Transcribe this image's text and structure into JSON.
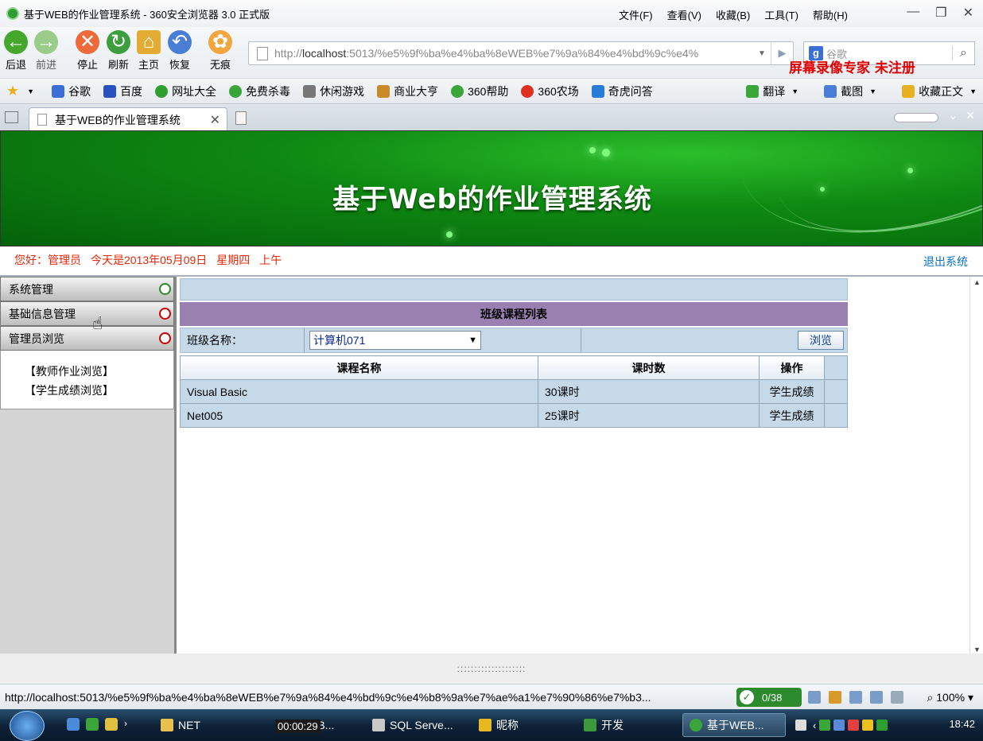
{
  "browser": {
    "window_title": "基于WEB的作业管理系统 - 360安全浏览器 3.0 正式版",
    "menus": [
      "文件(F)",
      "查看(V)",
      "收藏(B)",
      "工具(T)",
      "帮助(H)"
    ],
    "nav_buttons": {
      "back": "后退",
      "forward": "前进",
      "stop": "停止",
      "refresh": "刷新",
      "home": "主页",
      "restore": "恢复",
      "stealth": "无痕"
    },
    "address_prefix": "http://",
    "address_host": "localhost",
    "address_rest": ":5013/%e5%9f%ba%e4%ba%8eWEB%e7%9a%84%e4%bd%9c%e4%",
    "search_placeholder": "谷歌",
    "search_engine_icon": "g",
    "watermark": "屏幕录像专家  未注册",
    "favorites": [
      "谷歌",
      "百度",
      "网址大全",
      "免费杀毒",
      "休闲游戏",
      "商业大亨",
      "360帮助",
      "360农场",
      "奇虎问答"
    ],
    "fav_colors": [
      "#3a6fd8",
      "#2a52be",
      "#2e9e2e",
      "#3aa63a",
      "#777777",
      "#c98a2a",
      "#3aa63a",
      "#e03020",
      "#2a7ad8"
    ],
    "fav_right": [
      "翻译",
      "截图",
      "收藏正文"
    ],
    "tab_title": "基于WEB的作业管理系统",
    "status_url": "http://localhost:5013/%e5%9f%ba%e4%ba%8eWEB%e7%9a%84%e4%bd%9c%e4%b8%9a%e7%ae%a1%e7%90%86%e7%b3...",
    "counter": "0/38",
    "zoom": "100%"
  },
  "site": {
    "banner_title": "基于Web的作业管理系统",
    "greeting": "您好：管理员",
    "date": "今天是2013年05月09日",
    "weekday": "星期四",
    "period": "上午",
    "logout": "退出系统"
  },
  "sidebar": {
    "menus": [
      "系统管理",
      "基础信息管理",
      "管理员浏览"
    ],
    "items": [
      "【教师作业浏览】",
      "【学生成绩浏览】"
    ]
  },
  "main": {
    "list_title": "班级课程列表",
    "class_label": "班级名称：",
    "class_selected": "计算机071",
    "browse_button": "浏览",
    "columns": [
      "课程名称",
      "课时数",
      "操作"
    ],
    "rows": [
      {
        "name": "Visual Basic",
        "hours": "30课时",
        "action": "学生成绩"
      },
      {
        "name": "Net005",
        "hours": "25课时",
        "action": "学生成绩"
      }
    ],
    "splitter": "::::::::::::::::::::"
  },
  "taskbar": {
    "tasks": [
      "NET",
      "EB...",
      "SQL Serve...",
      "昵称",
      "开发",
      "基于WEB..."
    ],
    "recorder_time": "00:00:29",
    "clock": "18:42"
  },
  "colors": {
    "banner_green": "#0f8a12",
    "list_title_bg": "#9a80b0",
    "table_bg": "#c5d9e8",
    "greeting_red": "#e0280a",
    "link_blue": "#0b6fc4",
    "watermark_red": "#e00000"
  }
}
